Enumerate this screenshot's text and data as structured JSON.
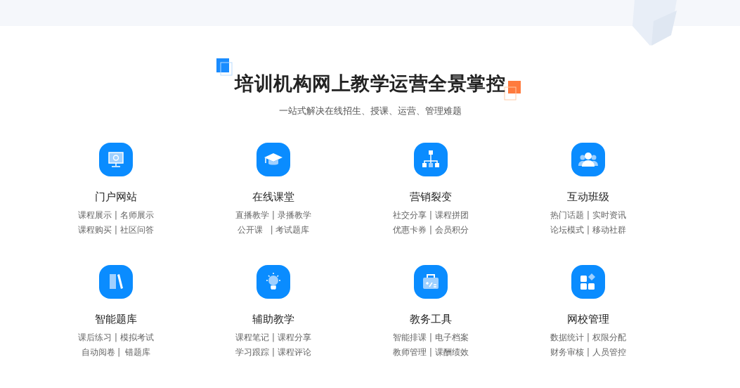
{
  "header": {
    "title": "培训机构网上教学运营全景掌控",
    "subtitle": "一站式解决在线招生、授课、运营、管理难题"
  },
  "features": [
    {
      "kind": "monitor",
      "title": "门户网站",
      "lines": [
        "课程展示 | 名师展示",
        "课程购买 | 社区问答"
      ]
    },
    {
      "kind": "cap",
      "title": "在线课堂",
      "lines": [
        "直播教学 | 录播教学",
        "公开课   | 考试题库"
      ]
    },
    {
      "kind": "network",
      "title": "营销裂变",
      "lines": [
        "社交分享 | 课程拼团",
        "优惠卡券 | 会员积分"
      ]
    },
    {
      "kind": "people",
      "title": "互动班级",
      "lines": [
        "热门话题 | 实时资讯",
        "论坛模式 | 移动社群"
      ]
    },
    {
      "kind": "books",
      "title": "智能题库",
      "lines": [
        "课后练习 | 模拟考试",
        "自动阅卷 |  错题库"
      ]
    },
    {
      "kind": "bulb",
      "title": "辅助教学",
      "lines": [
        "课程笔记 | 课程分享",
        "学习跟踪 | 课程评论"
      ]
    },
    {
      "kind": "toolbox",
      "title": "教务工具",
      "lines": [
        "智能排课 | 电子档案",
        "教师管理 | 课酬绩效"
      ]
    },
    {
      "kind": "grid",
      "title": "网校管理",
      "lines": [
        "数据统计 | 权限分配",
        "财务审核 | 人员管控"
      ]
    }
  ]
}
